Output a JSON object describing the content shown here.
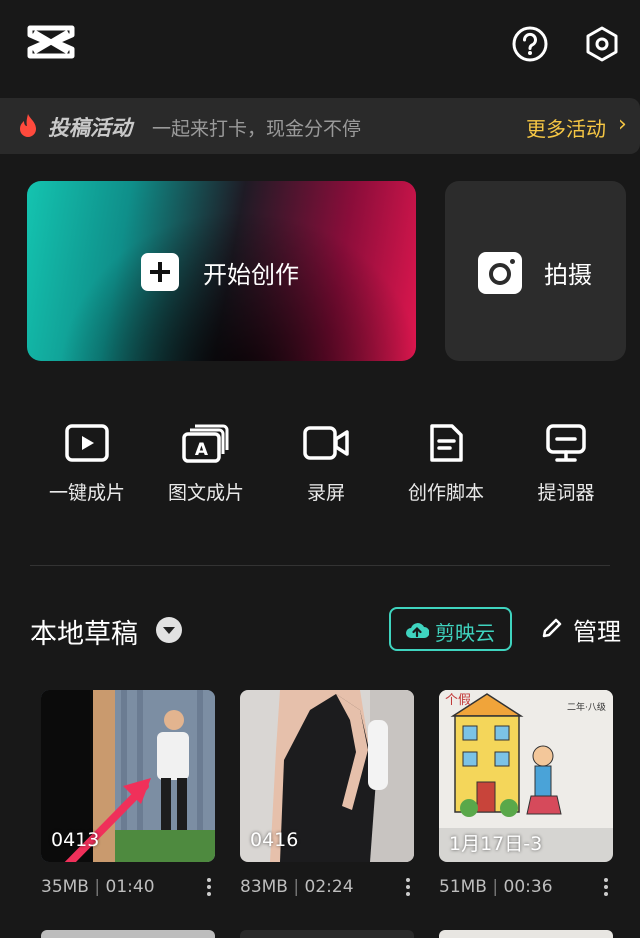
{
  "header": {
    "logo_icon": "capcut-logo-icon",
    "help_icon": "help-circle-icon",
    "settings_icon": "settings-hex-icon"
  },
  "banner": {
    "title": "投稿活动",
    "subtitle": "一起来打卡，现金分不停",
    "more_label": "更多活动",
    "chevron": "›",
    "accent": "#f6c744"
  },
  "main_actions": {
    "create_label": "开始创作",
    "shoot_label": "拍摄"
  },
  "tools": [
    {
      "label": "一键成片",
      "icon": "play-square-icon"
    },
    {
      "label": "图文成片",
      "icon": "image-text-icon"
    },
    {
      "label": "录屏",
      "icon": "video-camera-icon"
    },
    {
      "label": "创作脚本",
      "icon": "script-doc-icon"
    },
    {
      "label": "提词器",
      "icon": "teleprompter-icon"
    }
  ],
  "drafts": {
    "title": "本地草稿",
    "cloud_label": "剪映云",
    "manage_label": "管理",
    "accent": "#3fd4bf",
    "items": [
      {
        "name": "0413",
        "size": "35MB",
        "duration": "01:40"
      },
      {
        "name": "0416",
        "size": "83MB",
        "duration": "02:24"
      },
      {
        "name": "1月17日-3",
        "size": "51MB",
        "duration": "00:36"
      }
    ]
  }
}
